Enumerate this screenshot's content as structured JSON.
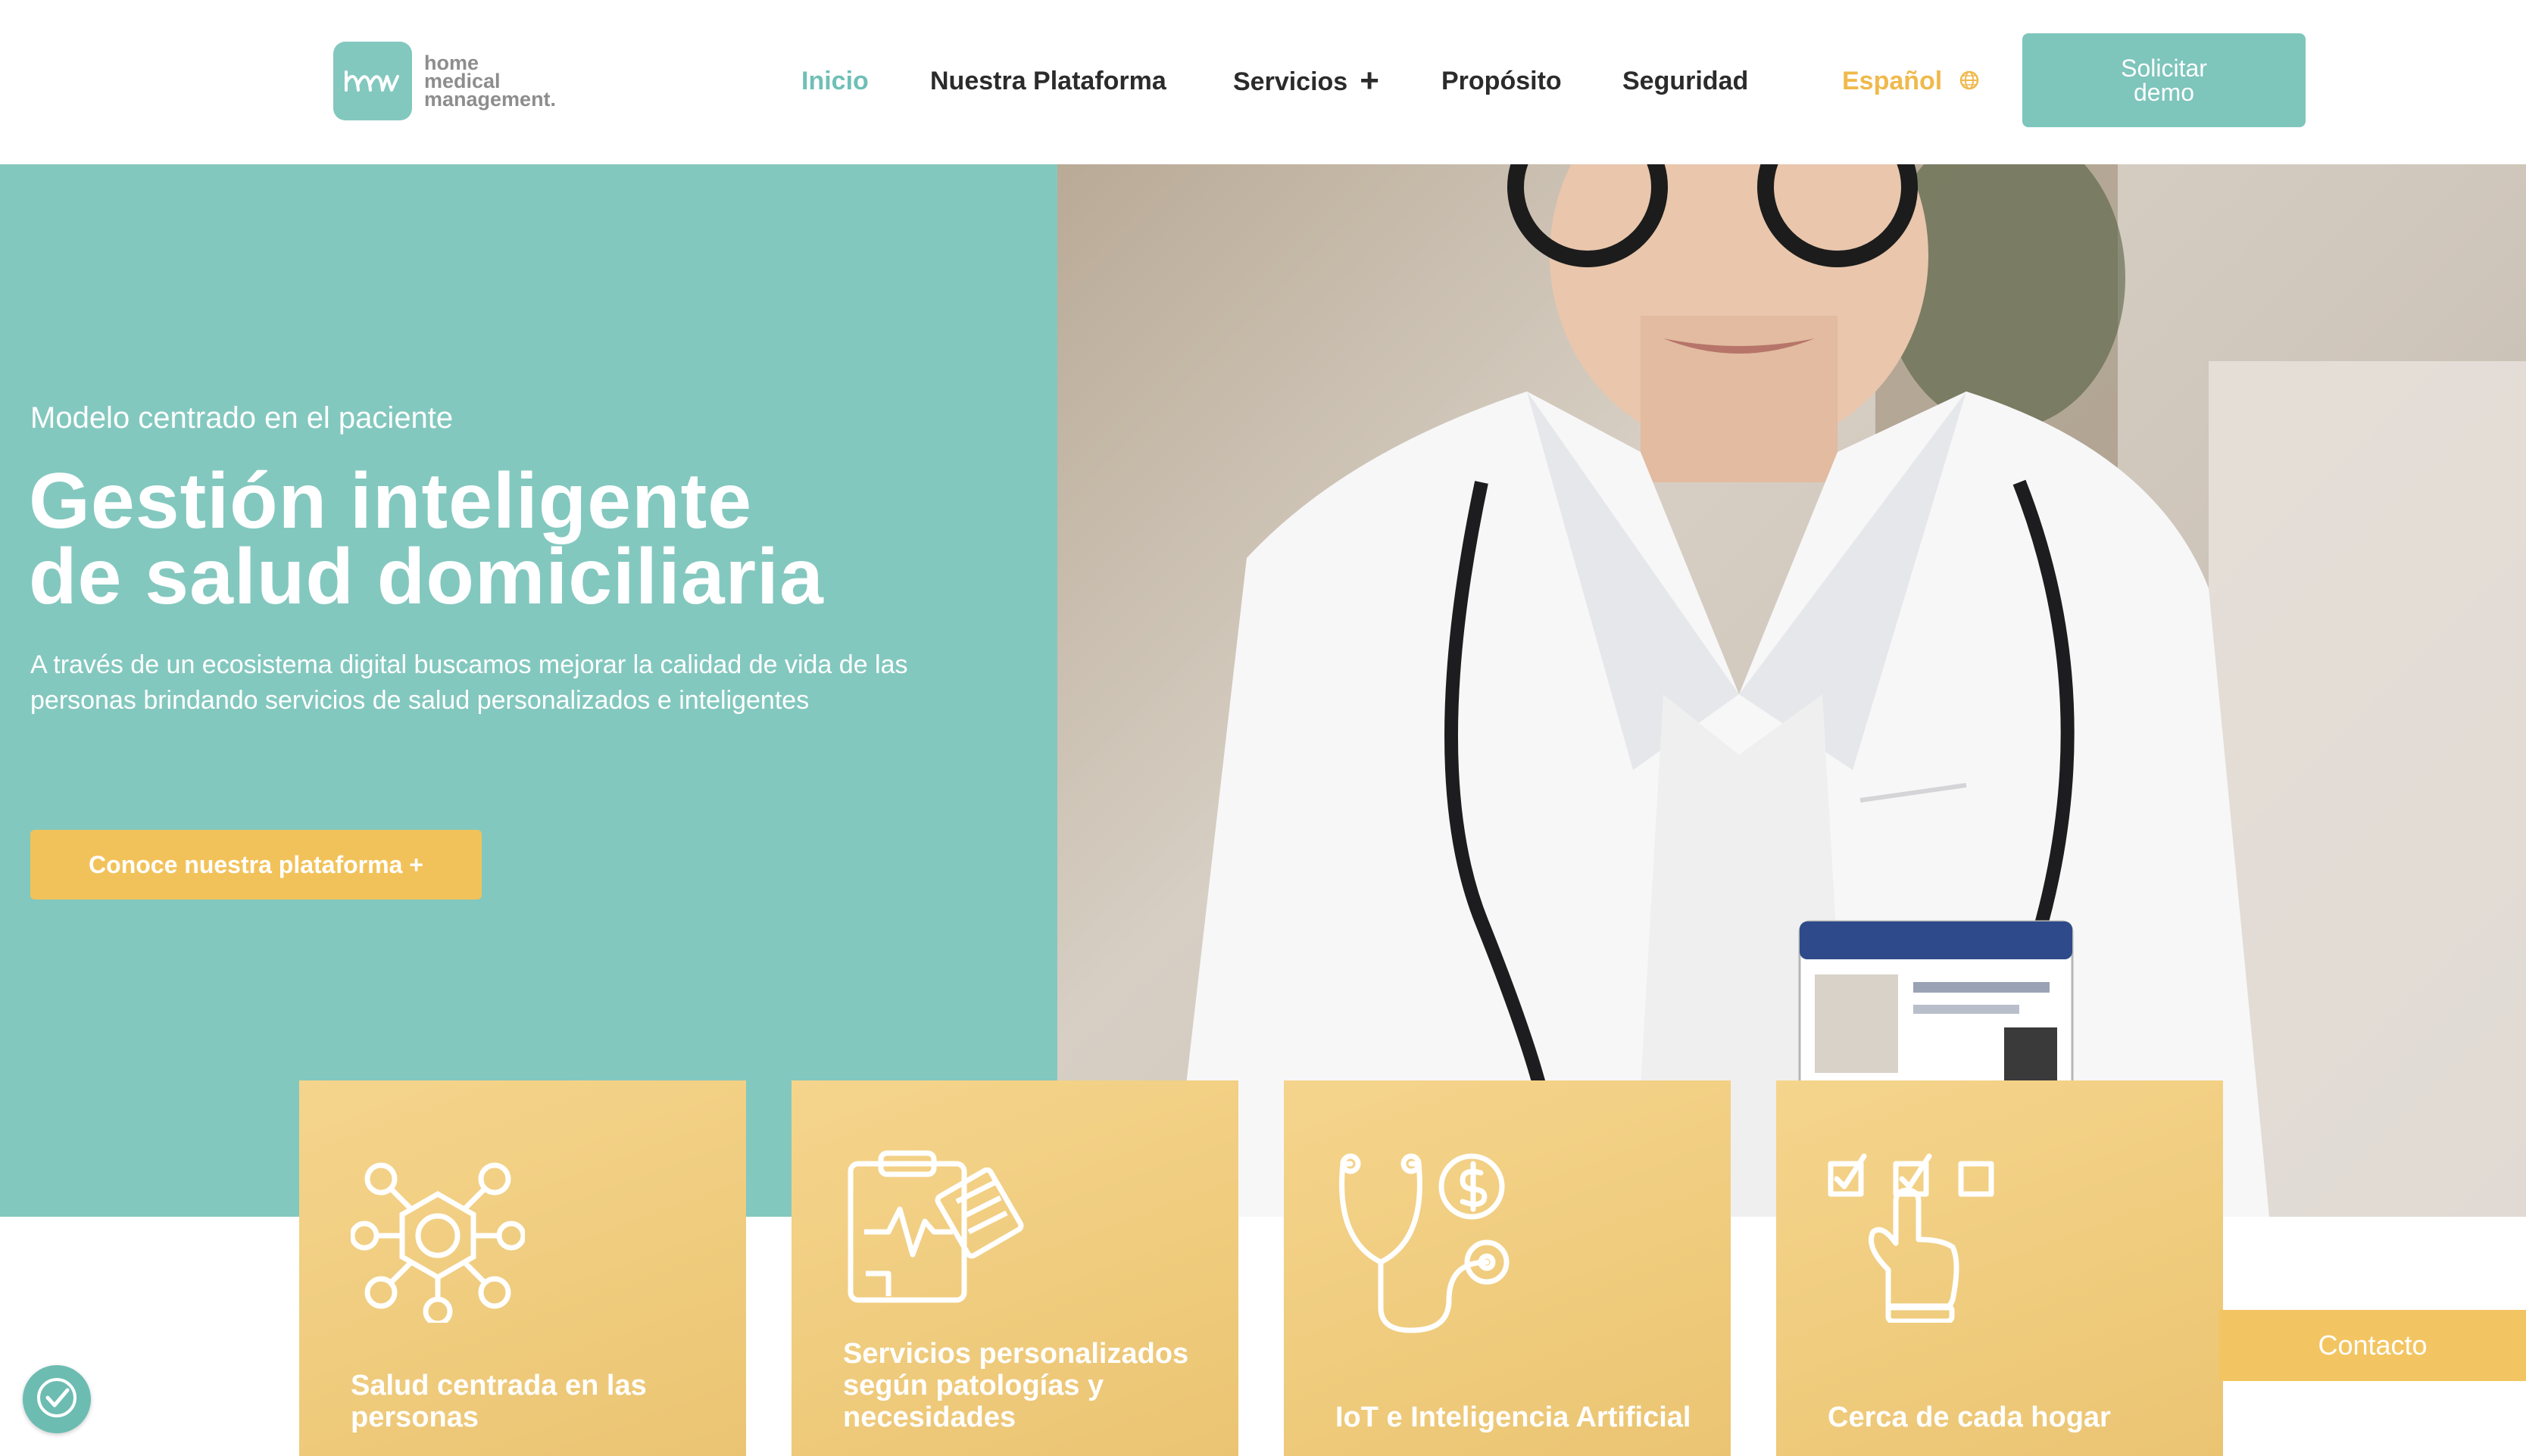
{
  "brand": {
    "logo_line1": "home",
    "logo_line2": "medical",
    "logo_line3": "management.",
    "accent": "#83c8bf",
    "cta_color": "#f2c25a"
  },
  "nav": {
    "items": [
      {
        "label": "Inicio",
        "active": true
      },
      {
        "label": "Nuestra Plataforma"
      },
      {
        "label": "Servicios"
      },
      {
        "label": "Propósito"
      },
      {
        "label": "Seguridad"
      }
    ],
    "language": "Español",
    "demo_line1": "Solicitar",
    "demo_line2": "demo"
  },
  "hero": {
    "subtitle": "Modelo centrado en el paciente",
    "title_line1": "Gestión inteligente",
    "title_line2": "de salud domiciliaria",
    "description": "A través de un ecosistema digital buscamos mejorar la calidad de vida de las personas brindando servicios de salud personalizados e inteligentes",
    "cta": "Conoce nuestra plataforma +"
  },
  "cards": [
    {
      "label": "Salud centrada en las personas",
      "icon": "network-icon"
    },
    {
      "label": "Servicios personalizados según patologías y necesidades",
      "icon": "clipboard-icon"
    },
    {
      "label": "IoT e Inteligencia Artificial",
      "icon": "stethoscope-icon"
    },
    {
      "label": "Cerca de cada hogar",
      "icon": "checklist-hand-icon"
    }
  ],
  "contact": "Contacto"
}
